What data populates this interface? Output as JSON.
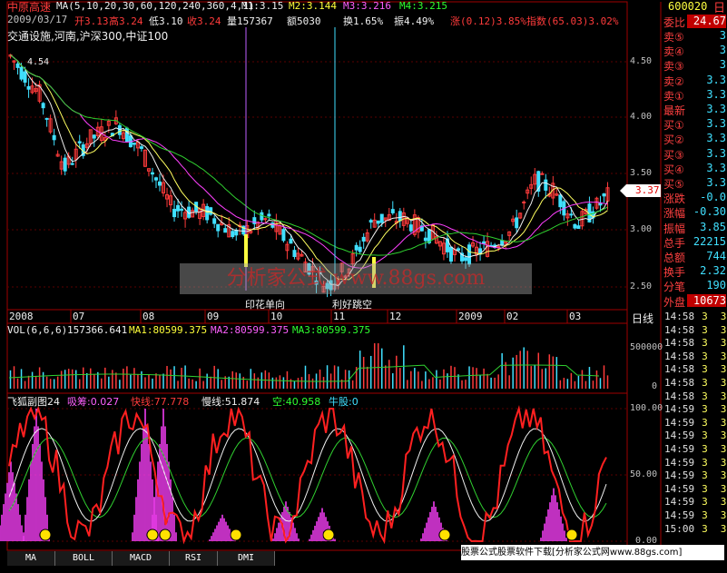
{
  "header": {
    "stock_name": "中原高速",
    "ma_params": "MA(5,10,20,30,60,120,240,360,4,1)",
    "m1": "M1:3.15",
    "m2": "M2:3.144",
    "m3": "M3:3.216",
    "m4": "M4:3.215",
    "date": "2009/03/17",
    "open": "开3.13",
    "high": "高3.24",
    "low": "低3.10",
    "close": "收3.24",
    "volume": "量157367",
    "amount": "额5030",
    "turnover": "换1.65%",
    "amplitude": "振4.49%",
    "change": "涨(0.12)3.85%",
    "index": "指数(65.03)3.02%",
    "sectors": "交通设施,河南,沪深300,中证100"
  },
  "price_axis": [
    "4.50",
    "4.00",
    "3.50",
    "3.00",
    "2.50"
  ],
  "current_price_tag": "3.37",
  "price_label_top": "4.54",
  "annotations": {
    "a1": "印花单向",
    "a2": "利好跳空"
  },
  "watermark": "分析家公式 www.88gs.com",
  "date_axis": [
    "2008",
    "07",
    "08",
    "09",
    "10",
    "11",
    "12",
    "2009",
    "02",
    "03"
  ],
  "period_label": "日线",
  "vol_header": {
    "title": "VOL(6,6,6)",
    "v": "157366.641",
    "ma1": "MA1:80599.375",
    "ma2": "MA2:80599.375",
    "ma3": "MA3:80599.375"
  },
  "vol_axis": [
    "500000",
    "0"
  ],
  "ind_header": {
    "title": "飞狐副图24",
    "a": "吸筹:0.027",
    "b": "快线:77.778",
    "c": "慢线:51.874",
    "d": "空:40.958",
    "e": "牛股:0"
  },
  "ind_axis": [
    "100.00",
    "50.00",
    "0.00"
  ],
  "tabs": [
    "MA",
    "BOLL",
    "MACD",
    "RSI",
    "DMI"
  ],
  "footer_link": "股票公式股票软件下载[分析家公式网www.88gs.com]",
  "quote": {
    "code": "600020",
    "weibi_label": "委比",
    "weibi_val": "24.67",
    "levels": [
      {
        "label": "卖⑤",
        "val": "3"
      },
      {
        "label": "卖④",
        "val": "3"
      },
      {
        "label": "卖③",
        "val": "3"
      },
      {
        "label": "卖②",
        "val": "3.3"
      },
      {
        "label": "卖①",
        "val": "3.3"
      },
      {
        "label": "最新",
        "val": "3.3"
      },
      {
        "label": "买①",
        "val": "3.3"
      },
      {
        "label": "买②",
        "val": "3.3"
      },
      {
        "label": "买③",
        "val": "3.3"
      },
      {
        "label": "买④",
        "val": "3.3"
      },
      {
        "label": "买⑤",
        "val": "3.3"
      },
      {
        "label": "涨跌",
        "val": "-0.0"
      },
      {
        "label": "涨幅",
        "val": "-0.30"
      },
      {
        "label": "振幅",
        "val": "3.85"
      },
      {
        "label": "总手",
        "val": "22215"
      },
      {
        "label": "总额",
        "val": "744"
      },
      {
        "label": "换手",
        "val": "2.32"
      },
      {
        "label": "分笔",
        "val": "190"
      },
      {
        "label": "外盘",
        "val": "10673"
      }
    ],
    "ticks": [
      {
        "t": "14:58",
        "p": "3",
        "v": "3"
      },
      {
        "t": "14:58",
        "p": "3",
        "v": "3"
      },
      {
        "t": "14:58",
        "p": "3",
        "v": "3"
      },
      {
        "t": "14:58",
        "p": "3",
        "v": "3"
      },
      {
        "t": "14:58",
        "p": "3",
        "v": "3"
      },
      {
        "t": "14:58",
        "p": "3",
        "v": "3"
      },
      {
        "t": "14:58",
        "p": "3",
        "v": "3"
      },
      {
        "t": "14:59",
        "p": "3",
        "v": "3"
      },
      {
        "t": "14:59",
        "p": "3",
        "v": "3"
      },
      {
        "t": "14:59",
        "p": "3",
        "v": "3"
      },
      {
        "t": "14:59",
        "p": "3",
        "v": "3"
      },
      {
        "t": "14:59",
        "p": "3",
        "v": "3"
      },
      {
        "t": "14:59",
        "p": "3",
        "v": "3"
      },
      {
        "t": "14:59",
        "p": "3",
        "v": "3"
      },
      {
        "t": "14:59",
        "p": "3",
        "v": "3"
      },
      {
        "t": "14:59",
        "p": "3",
        "v": "3"
      },
      {
        "t": "15:00",
        "p": "3",
        "v": "3"
      }
    ]
  },
  "colors": {
    "up": "#ff3b3b",
    "down": "#40e0ff",
    "ma_white": "#f0f0f0",
    "ma_yellow": "#ffff60",
    "ma_magenta": "#ff40ff",
    "ma_green": "#30d030"
  }
}
